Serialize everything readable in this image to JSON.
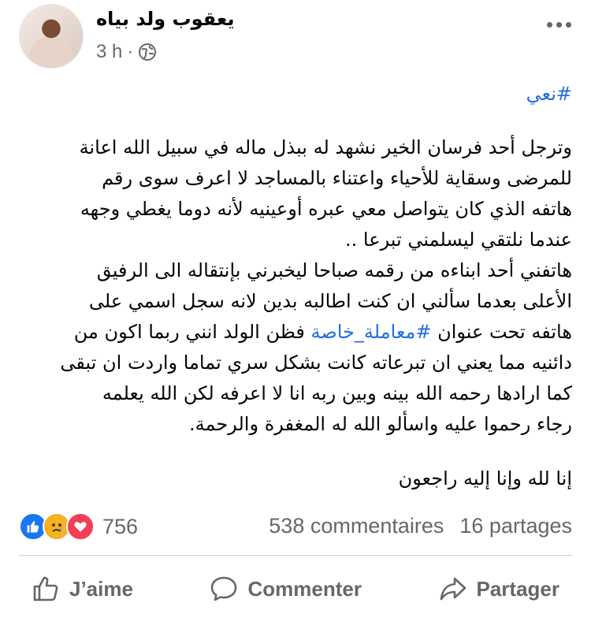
{
  "post": {
    "author": "يعقوب ولد بياه",
    "time": "3 h",
    "separator": "·",
    "hashtag": "#نعي",
    "lines": [
      "وترجل أحد فرسان الخير نشهد له ببذل ماله في سبيل الله اعانة",
      "للمرضى وسقاية للأحياء واعتناء بالمساجد لا اعرف سوى رقم",
      "هاتفه الذي كان يتواصل معي عبره أوعينيه لأنه دوما يغطي وجهه",
      "عندما نلتقي ليسلمني تبرعا ..",
      "هاتفني أحد ابناءه من رقمه صباحا ليخبرني بإنتقاله الى الرفيق",
      "الأعلى بعدما سألني ان كنت اطالبه بدين لانه سجل اسمي على"
    ],
    "line7_before": "هاتفه تحت عنوان ",
    "line7_hashtag": "#معاملة_خاصة",
    "line7_after": " فظن الولد انني ربما اكون من",
    "lines_after": [
      "دائنيه مما يعني ان تبرعاته كانت بشكل سري تماما واردت ان تبقى",
      "كما ارادها رحمه الله بينه وبين ربه انا لا اعرفه لكن الله يعلمه",
      "رجاء رحموا عليه واسألو الله له المغفرة والرحمة."
    ],
    "closing": "إنا لله وإنا إليه راجعون"
  },
  "engagement": {
    "reaction_count": "756",
    "comments": "538 commentaires",
    "shares": "16 partages"
  },
  "actions": {
    "like": "J’aime",
    "comment": "Commenter",
    "share": "Partager"
  },
  "colors": {
    "hashtag": "#216fdb",
    "secondary_text": "#65676b",
    "like_blue": "#1877f2",
    "love_red": "#f33e58",
    "sad_yellow": "#f7b125"
  },
  "icons": [
    "profile-avatar",
    "globe-icon",
    "more-options-icon",
    "like-reaction-icon",
    "sad-reaction-icon",
    "love-reaction-icon",
    "thumbs-up-icon",
    "comment-bubble-icon",
    "share-arrow-icon"
  ]
}
